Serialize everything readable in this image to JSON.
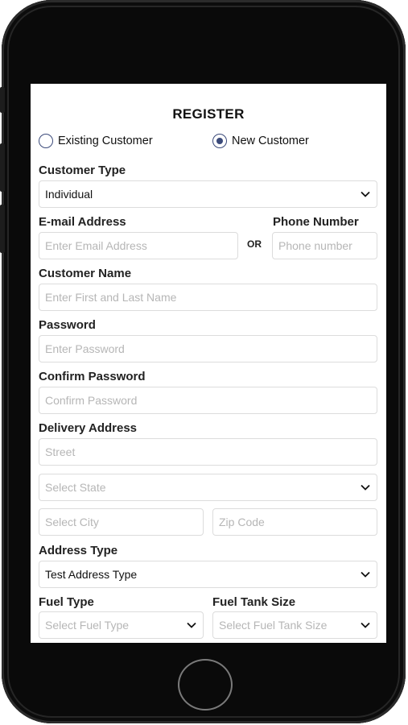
{
  "form": {
    "title": "REGISTER",
    "customer_options": [
      {
        "label": "Existing Customer",
        "selected": false
      },
      {
        "label": "New Customer",
        "selected": true
      }
    ],
    "customer_type": {
      "label": "Customer Type",
      "value": "Individual"
    },
    "email": {
      "label": "E-mail Address",
      "placeholder": "Enter Email Address"
    },
    "or_text": "OR",
    "phone": {
      "label": "Phone Number",
      "placeholder": "Phone number"
    },
    "customer_name": {
      "label": "Customer Name",
      "placeholder": "Enter First and Last Name"
    },
    "password": {
      "label": "Password",
      "placeholder": "Enter Password"
    },
    "confirm_password": {
      "label": "Confirm Password",
      "placeholder": "Confirm Password"
    },
    "delivery_address": {
      "label": "Delivery Address",
      "street_placeholder": "Street",
      "state_placeholder": "Select State",
      "city_placeholder": "Select City",
      "zip_placeholder": "Zip Code"
    },
    "address_type": {
      "label": "Address Type",
      "value": "Test Address Type"
    },
    "fuel_type": {
      "label": "Fuel Type",
      "placeholder": "Select Fuel Type"
    },
    "fuel_tank_size": {
      "label": "Fuel Tank Size",
      "placeholder": "Select Fuel Tank Size"
    }
  },
  "colors": {
    "accent": "#3b4a7a",
    "border": "#dcdcdc",
    "placeholder": "#b6b6b6",
    "bezel": "#0a0a0a"
  },
  "icons": [
    "chevron-down-icon",
    "radio-button-icon",
    "home-button"
  ]
}
